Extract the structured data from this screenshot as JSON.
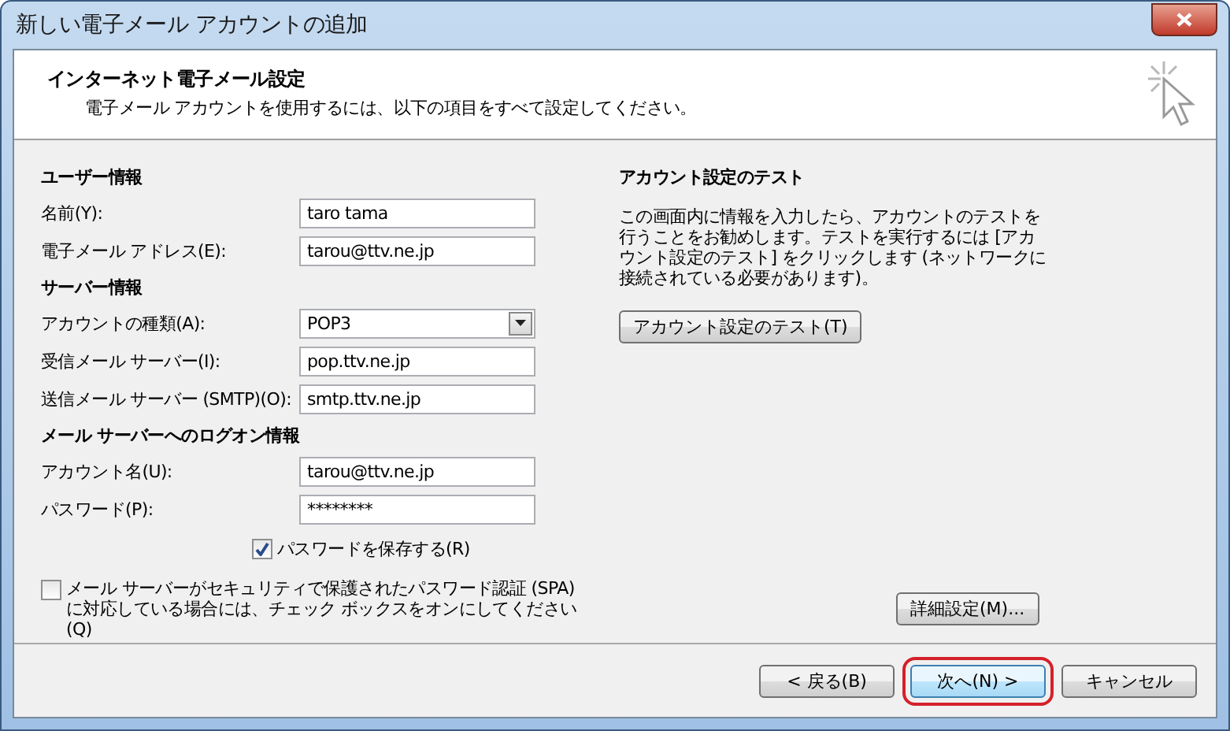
{
  "window": {
    "title": "新しい電子メール アカウントの追加"
  },
  "header": {
    "title": "インターネット電子メール設定",
    "subtitle": "電子メール アカウントを使用するには、以下の項目をすべて設定してください。"
  },
  "sections": [
    {
      "title": "ユーザー情報",
      "fields": [
        {
          "label": "名前(Y):",
          "kind": "text",
          "value": "taro tama"
        },
        {
          "label": "電子メール アドレス(E):",
          "kind": "text",
          "value": "tarou@ttv.ne.jp"
        }
      ]
    },
    {
      "title": "サーバー情報",
      "fields": [
        {
          "label": "アカウントの種類(A):",
          "kind": "dropdown",
          "value": "POP3"
        },
        {
          "label": "受信メール サーバー(I):",
          "kind": "text",
          "value": "pop.ttv.ne.jp"
        },
        {
          "label": "送信メール サーバー (SMTP)(O):",
          "kind": "text",
          "value": "smtp.ttv.ne.jp"
        }
      ]
    },
    {
      "title": "メール サーバーへのログオン情報",
      "fields": [
        {
          "label": "アカウント名(U):",
          "kind": "text",
          "value": "tarou@ttv.ne.jp"
        },
        {
          "label": "パスワード(P):",
          "kind": "text",
          "value": "********"
        }
      ]
    }
  ],
  "remember_password": {
    "label": "パスワードを保存する(R)",
    "checked": true
  },
  "spa": {
    "label": "メール サーバーがセキュリティで保護されたパスワード認証 (SPA) に対応している場合には、チェック ボックスをオンにしてください(Q)",
    "checked": false
  },
  "test": {
    "title": "アカウント設定のテスト",
    "description": "この画面内に情報を入力したら、アカウントのテストを行うことをお勧めします。テストを実行するには [アカウント設定のテスト] をクリックします (ネットワークに接続されている必要があります)。",
    "button": "アカウント設定のテスト(T)"
  },
  "advanced_button": "詳細設定(M)...",
  "footer_buttons": [
    {
      "label": "< 戻る(B)",
      "highlighted": false
    },
    {
      "label": "次へ(N) >",
      "highlighted": true
    },
    {
      "label": "キャンセル",
      "highlighted": false
    }
  ]
}
